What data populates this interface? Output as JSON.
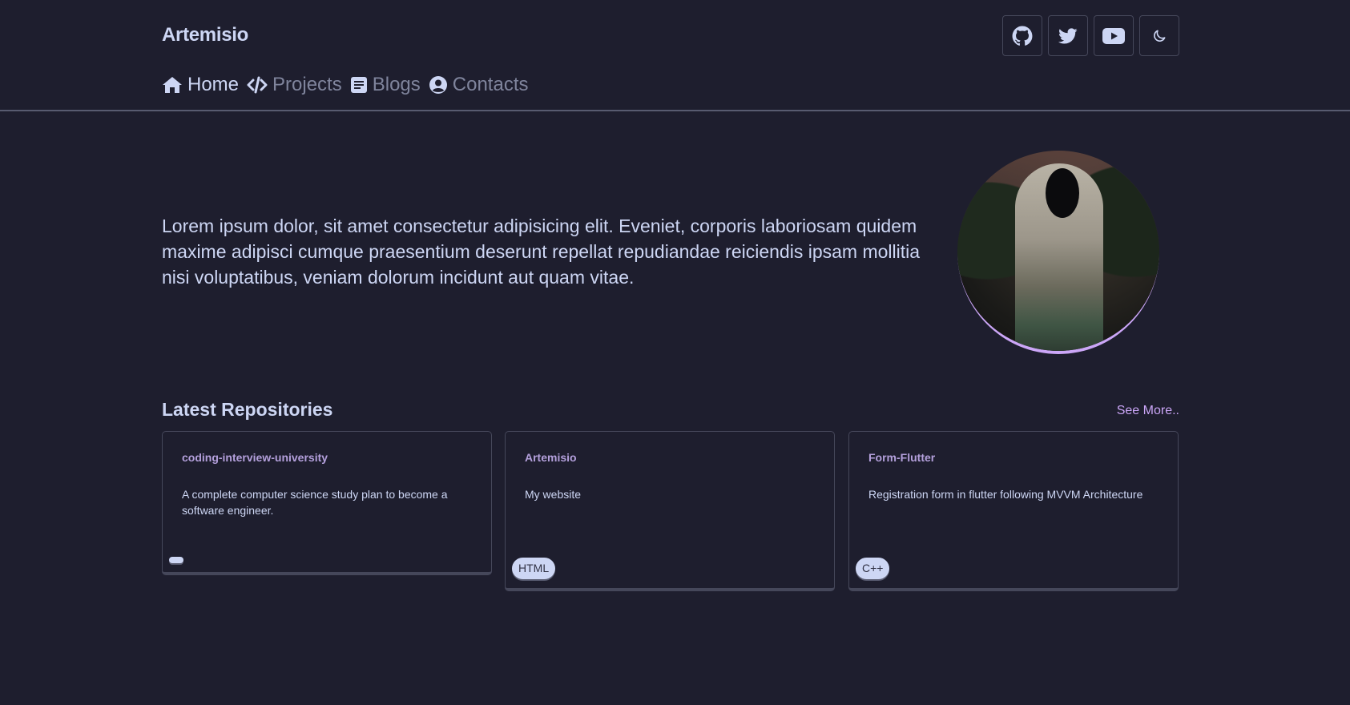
{
  "brand": "Artemisio",
  "social": [
    {
      "icon": "github-icon"
    },
    {
      "icon": "twitter-icon"
    },
    {
      "icon": "youtube-icon"
    },
    {
      "icon": "moon-icon"
    }
  ],
  "nav": [
    {
      "label": "Home",
      "icon": "home-icon",
      "active": true
    },
    {
      "label": "Projects",
      "icon": "code-icon",
      "active": false
    },
    {
      "label": "Blogs",
      "icon": "document-icon",
      "active": false
    },
    {
      "label": "Contacts",
      "icon": "user-circle-icon",
      "active": false
    }
  ],
  "hero": {
    "text": "Lorem ipsum dolor, sit amet consectetur adipisicing elit. Eveniet, corporis laboriosam quidem maxime adipisci cumque praesentium deserunt repellat repudiandae reiciendis ipsam mollitia nisi voluptatibus, veniam dolorum incidunt aut quam vitae."
  },
  "repos": {
    "title": "Latest Repositories",
    "see_more": "See More..",
    "items": [
      {
        "name": "coding-interview-university",
        "description": "A complete computer science study plan to become a software engineer.",
        "language": ""
      },
      {
        "name": "Artemisio",
        "description": "My website",
        "language": "HTML"
      },
      {
        "name": "Form-Flutter",
        "description": "Registration form in flutter following MVVM Architecture",
        "language": "C++"
      }
    ]
  },
  "colors": {
    "background": "#1e1e2e",
    "text": "#cdd6f4",
    "muted": "#7f849c",
    "accent": "#cba6f7",
    "border": "#45475a"
  }
}
